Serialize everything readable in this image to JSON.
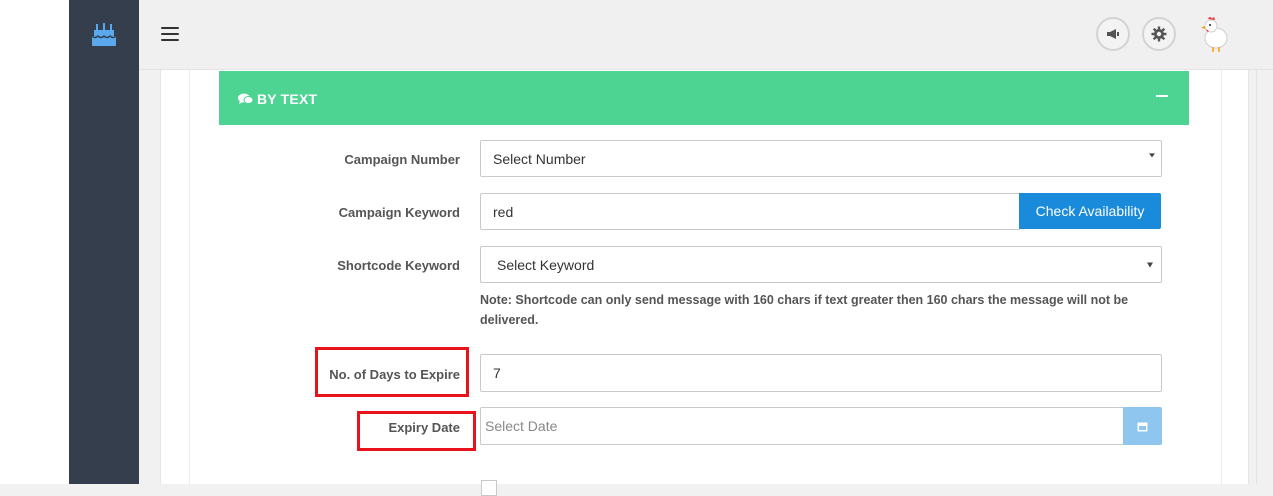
{
  "topbar": {
    "menu_icon": "hamburger-icon",
    "announce_icon": "megaphone-icon",
    "settings_icon": "gear-icon",
    "avatar_icon": "chicken-avatar"
  },
  "sidebar": {
    "logo_icon": "cake-icon",
    "color": "#343e4c"
  },
  "panel": {
    "title": "BY TEXT",
    "title_icon": "comments-icon",
    "collapse_icon": "minus-icon",
    "header_color": "#4dd493"
  },
  "form": {
    "campaign_number": {
      "label": "Campaign Number",
      "value": "Select Number"
    },
    "campaign_keyword": {
      "label": "Campaign Keyword",
      "value": "red",
      "button": "Check Availability"
    },
    "shortcode_keyword": {
      "label": "Shortcode Keyword",
      "value": "Select Keyword"
    },
    "note": "Note: Shortcode can only send message with 160 chars if text greater then 160 chars the message will not be delivered.",
    "days_to_expire": {
      "label": "No. of Days to Expire",
      "value": "7"
    },
    "expiry_date": {
      "label": "Expiry Date",
      "placeholder": "Select Date",
      "button_icon": "calendar-icon"
    }
  },
  "colors": {
    "accent_blue": "#1a8adb",
    "highlight_red": "#e8121a"
  }
}
